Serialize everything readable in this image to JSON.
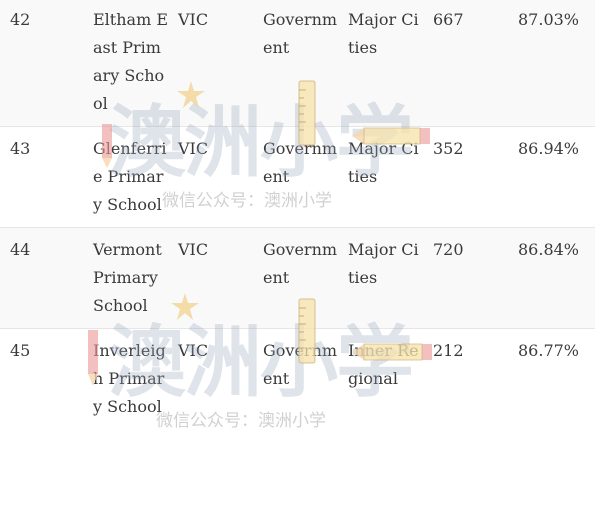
{
  "rows": [
    {
      "rank": "42",
      "school": "Eltham East Primary School",
      "state": "VIC",
      "sector": "Government",
      "location": "Major Cities",
      "enrolments": "667",
      "score": "87.03%"
    },
    {
      "rank": "43",
      "school": "Glenferrie Primary School",
      "state": "VIC",
      "sector": "Government",
      "location": "Major Cities",
      "enrolments": "352",
      "score": "86.94%"
    },
    {
      "rank": "44",
      "school": "Vermont Primary School",
      "state": "VIC",
      "sector": "Government",
      "location": "Major Cities",
      "enrolments": "720",
      "score": "86.84%"
    },
    {
      "rank": "45",
      "school": "Inverleigh Primary School",
      "state": "VIC",
      "sector": "Government",
      "location": "Inner Regional",
      "enrolments": "212",
      "score": "86.77%"
    }
  ],
  "watermark": {
    "logo_text": "澳洲小学",
    "caption": "微信公众号：澳洲小学"
  },
  "colors": {
    "row_alt": "#f9f9f9",
    "divider": "#e6e6e6",
    "text": "#3a3a3a"
  },
  "icons": [
    "star-icon",
    "ruler-icon",
    "pencil-icon"
  ]
}
